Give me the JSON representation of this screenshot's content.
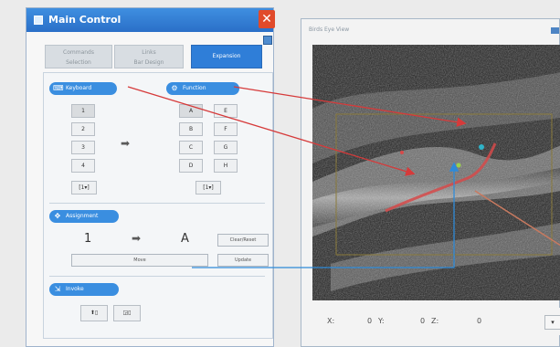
{
  "main_control": {
    "title": "Main Control",
    "close_icon": "close-x-icon",
    "tabs": [
      {
        "label_1": "Commands",
        "label_2": "Selection"
      },
      {
        "label_1": "Links",
        "label_2": "Bar Design"
      },
      {
        "label_1": "Expansion",
        "label_2": ""
      }
    ],
    "sections": {
      "keyboard": {
        "label": "Keyboard",
        "icon": "keyboard-icon"
      },
      "function": {
        "label": "Function",
        "icon": "function-icon"
      },
      "assignment": {
        "label": "Assignment",
        "icon": "move-icon"
      },
      "invoke": {
        "label": "Invoke",
        "icon": "invoke-icon"
      }
    },
    "left_keys": [
      "1",
      "2",
      "3",
      "4"
    ],
    "right_keys": [
      [
        "A",
        "E"
      ],
      [
        "B",
        "F"
      ],
      [
        "C",
        "G"
      ],
      [
        "D",
        "H"
      ]
    ],
    "left_stepper": "[1▾]",
    "right_stepper": "[1▾]",
    "assign": {
      "from": "1",
      "to": "A",
      "clear_label": "Clear/Reset",
      "wide_label": "Move",
      "small_label": "Update"
    },
    "invoke_buttons": [
      "⬆▯",
      "◲▯"
    ],
    "arrow_glyph": "➡"
  },
  "birds_eye": {
    "title": "Birds Eye View",
    "x_label": "X:",
    "x_value": "0",
    "y_label": "Y:",
    "y_value": "0",
    "z_label": "Z:",
    "z_value": "0",
    "dropdown_glyph": "▾"
  },
  "colors": {
    "accent": "#3a8ee0",
    "arrow_red": "#d63a3a",
    "arrow_blue": "#2e8ad8"
  }
}
